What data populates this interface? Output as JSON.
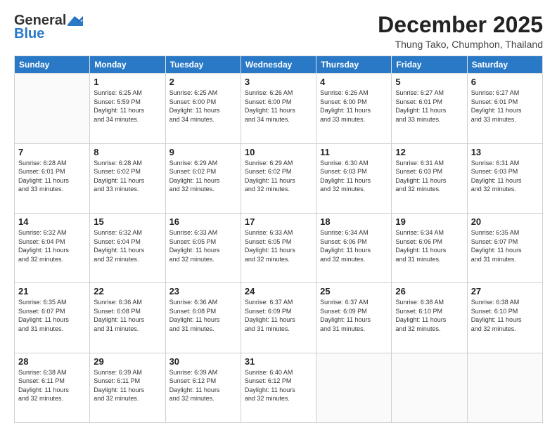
{
  "header": {
    "logo_general": "General",
    "logo_blue": "Blue",
    "month_year": "December 2025",
    "location": "Thung Tako, Chumphon, Thailand"
  },
  "days_of_week": [
    "Sunday",
    "Monday",
    "Tuesday",
    "Wednesday",
    "Thursday",
    "Friday",
    "Saturday"
  ],
  "weeks": [
    [
      {
        "day": "",
        "info": ""
      },
      {
        "day": "1",
        "info": "Sunrise: 6:25 AM\nSunset: 5:59 PM\nDaylight: 11 hours\nand 34 minutes."
      },
      {
        "day": "2",
        "info": "Sunrise: 6:25 AM\nSunset: 6:00 PM\nDaylight: 11 hours\nand 34 minutes."
      },
      {
        "day": "3",
        "info": "Sunrise: 6:26 AM\nSunset: 6:00 PM\nDaylight: 11 hours\nand 34 minutes."
      },
      {
        "day": "4",
        "info": "Sunrise: 6:26 AM\nSunset: 6:00 PM\nDaylight: 11 hours\nand 33 minutes."
      },
      {
        "day": "5",
        "info": "Sunrise: 6:27 AM\nSunset: 6:01 PM\nDaylight: 11 hours\nand 33 minutes."
      },
      {
        "day": "6",
        "info": "Sunrise: 6:27 AM\nSunset: 6:01 PM\nDaylight: 11 hours\nand 33 minutes."
      }
    ],
    [
      {
        "day": "7",
        "info": "Sunrise: 6:28 AM\nSunset: 6:01 PM\nDaylight: 11 hours\nand 33 minutes."
      },
      {
        "day": "8",
        "info": "Sunrise: 6:28 AM\nSunset: 6:02 PM\nDaylight: 11 hours\nand 33 minutes."
      },
      {
        "day": "9",
        "info": "Sunrise: 6:29 AM\nSunset: 6:02 PM\nDaylight: 11 hours\nand 32 minutes."
      },
      {
        "day": "10",
        "info": "Sunrise: 6:29 AM\nSunset: 6:02 PM\nDaylight: 11 hours\nand 32 minutes."
      },
      {
        "day": "11",
        "info": "Sunrise: 6:30 AM\nSunset: 6:03 PM\nDaylight: 11 hours\nand 32 minutes."
      },
      {
        "day": "12",
        "info": "Sunrise: 6:31 AM\nSunset: 6:03 PM\nDaylight: 11 hours\nand 32 minutes."
      },
      {
        "day": "13",
        "info": "Sunrise: 6:31 AM\nSunset: 6:03 PM\nDaylight: 11 hours\nand 32 minutes."
      }
    ],
    [
      {
        "day": "14",
        "info": "Sunrise: 6:32 AM\nSunset: 6:04 PM\nDaylight: 11 hours\nand 32 minutes."
      },
      {
        "day": "15",
        "info": "Sunrise: 6:32 AM\nSunset: 6:04 PM\nDaylight: 11 hours\nand 32 minutes."
      },
      {
        "day": "16",
        "info": "Sunrise: 6:33 AM\nSunset: 6:05 PM\nDaylight: 11 hours\nand 32 minutes."
      },
      {
        "day": "17",
        "info": "Sunrise: 6:33 AM\nSunset: 6:05 PM\nDaylight: 11 hours\nand 32 minutes."
      },
      {
        "day": "18",
        "info": "Sunrise: 6:34 AM\nSunset: 6:06 PM\nDaylight: 11 hours\nand 32 minutes."
      },
      {
        "day": "19",
        "info": "Sunrise: 6:34 AM\nSunset: 6:06 PM\nDaylight: 11 hours\nand 31 minutes."
      },
      {
        "day": "20",
        "info": "Sunrise: 6:35 AM\nSunset: 6:07 PM\nDaylight: 11 hours\nand 31 minutes."
      }
    ],
    [
      {
        "day": "21",
        "info": "Sunrise: 6:35 AM\nSunset: 6:07 PM\nDaylight: 11 hours\nand 31 minutes."
      },
      {
        "day": "22",
        "info": "Sunrise: 6:36 AM\nSunset: 6:08 PM\nDaylight: 11 hours\nand 31 minutes."
      },
      {
        "day": "23",
        "info": "Sunrise: 6:36 AM\nSunset: 6:08 PM\nDaylight: 11 hours\nand 31 minutes."
      },
      {
        "day": "24",
        "info": "Sunrise: 6:37 AM\nSunset: 6:09 PM\nDaylight: 11 hours\nand 31 minutes."
      },
      {
        "day": "25",
        "info": "Sunrise: 6:37 AM\nSunset: 6:09 PM\nDaylight: 11 hours\nand 31 minutes."
      },
      {
        "day": "26",
        "info": "Sunrise: 6:38 AM\nSunset: 6:10 PM\nDaylight: 11 hours\nand 32 minutes."
      },
      {
        "day": "27",
        "info": "Sunrise: 6:38 AM\nSunset: 6:10 PM\nDaylight: 11 hours\nand 32 minutes."
      }
    ],
    [
      {
        "day": "28",
        "info": "Sunrise: 6:38 AM\nSunset: 6:11 PM\nDaylight: 11 hours\nand 32 minutes."
      },
      {
        "day": "29",
        "info": "Sunrise: 6:39 AM\nSunset: 6:11 PM\nDaylight: 11 hours\nand 32 minutes."
      },
      {
        "day": "30",
        "info": "Sunrise: 6:39 AM\nSunset: 6:12 PM\nDaylight: 11 hours\nand 32 minutes."
      },
      {
        "day": "31",
        "info": "Sunrise: 6:40 AM\nSunset: 6:12 PM\nDaylight: 11 hours\nand 32 minutes."
      },
      {
        "day": "",
        "info": ""
      },
      {
        "day": "",
        "info": ""
      },
      {
        "day": "",
        "info": ""
      }
    ]
  ]
}
